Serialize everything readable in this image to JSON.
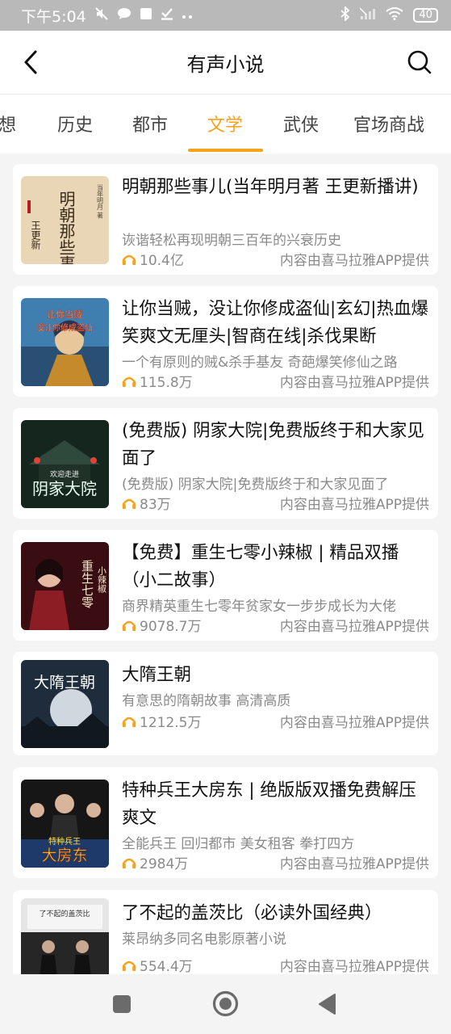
{
  "status_bar": {
    "time": "下午5:04",
    "battery": "40",
    "text_color": "#ffffff",
    "background": "#b9b9b9"
  },
  "header": {
    "title": "有声小说",
    "back_icon": "chevron-left-icon",
    "search_icon": "search-icon"
  },
  "tabs": [
    {
      "label": "想",
      "active": false
    },
    {
      "label": "历史",
      "active": false
    },
    {
      "label": "都市",
      "active": false
    },
    {
      "label": "文学",
      "active": true
    },
    {
      "label": "武侠",
      "active": false
    },
    {
      "label": "官场商战",
      "active": false
    }
  ],
  "accent_color": "#f7a21b",
  "items": [
    {
      "title": "明朝那些事儿(当年明月著 王更新播讲)",
      "subtitle": "诙谐轻松再现明朝三百年的兴衰历史",
      "plays": "10.4亿",
      "provider": "内容由喜马拉雅APP提供",
      "cover_text": "明朝那些事儿",
      "cover_small": "当年明月 著",
      "cover_author": "王更新"
    },
    {
      "title": "让你当贼，没让你修成盗仙|玄幻|热血爆笑爽文无厘头|智商在线|杀伐果断",
      "subtitle": "一个有原则的贼&杀手基友 奇葩爆笑修仙之路",
      "plays": "115.8万",
      "provider": "内容由喜马拉雅APP提供",
      "cover_text": "没让你修成盗仙",
      "cover_small": "让你当贼",
      "cover_author": ""
    },
    {
      "title": "(免费版) 阴家大院|免费版终于和大家见面了",
      "subtitle": "(免费版) 阴家大院|免费版终于和大家见面了",
      "plays": "83万",
      "provider": "内容由喜马拉雅APP提供",
      "cover_text": "阴家大院",
      "cover_small": "欢迎走进",
      "cover_author": ""
    },
    {
      "title": "【免费】重生七零小辣椒 | 精品双播（小二故事）",
      "subtitle": "商界精英重生七零年贫家女一步步成长为大佬",
      "plays": "9078.7万",
      "provider": "内容由喜马拉雅APP提供",
      "cover_text": "重生七零",
      "cover_small": "小辣椒",
      "cover_author": ""
    },
    {
      "title": "大隋王朝",
      "subtitle": "有意思的隋朝故事 高清高质",
      "plays": "1212.5万",
      "provider": "内容由喜马拉雅APP提供",
      "cover_text": "大隋王朝",
      "cover_small": "",
      "cover_author": ""
    },
    {
      "title": "特种兵王大房东 | 绝版版双播免费解压爽文",
      "subtitle": "全能兵王 回归都市 美女租客 拳打四方",
      "plays": "2984万",
      "provider": "内容由喜马拉雅APP提供",
      "cover_text": "大房东",
      "cover_small": "特种兵王",
      "cover_author": ""
    },
    {
      "title": "了不起的盖茨比（必读外国经典）",
      "subtitle": "莱昂纳多同名电影原著小说",
      "plays": "554.4万",
      "provider": "内容由喜马拉雅APP提供",
      "cover_text": "了不起的盖茨比",
      "cover_small": "",
      "cover_author": ""
    }
  ],
  "system_nav": {
    "recents_icon": "square-icon",
    "home_icon": "circle-home-icon",
    "back_icon": "triangle-back-icon"
  }
}
